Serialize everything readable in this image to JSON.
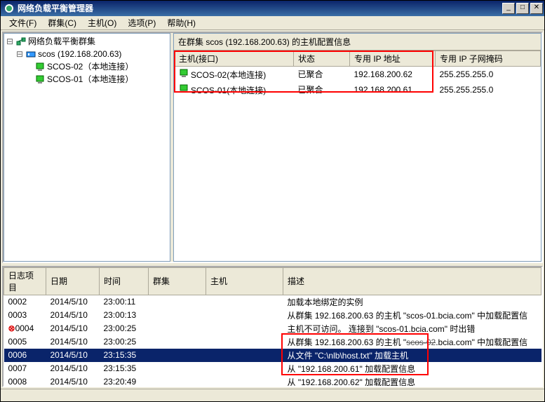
{
  "window": {
    "title": "网络负载平衡管理器"
  },
  "menus": {
    "file": "文件(F)",
    "cluster": "群集(C)",
    "host": "主机(O)",
    "options": "选项(P)",
    "help": "帮助(H)"
  },
  "tree": {
    "root": "网络负载平衡群集",
    "cluster": "scos (192.168.200.63)",
    "hosts": [
      "SCOS-02（本地连接）",
      "SCOS-01（本地连接）"
    ]
  },
  "list": {
    "caption": "在群集 scos (192.168.200.63) 的主机配置信息",
    "headers": {
      "host": "主机(接口)",
      "status": "状态",
      "dip": "专用 IP 地址",
      "mask": "专用 IP 子网掩码"
    },
    "rows": [
      {
        "host": "SCOS-02(本地连接)",
        "status": "已聚合",
        "dip": "192.168.200.62",
        "mask": "255.255.255.0"
      },
      {
        "host": "SCOS-01(本地连接)",
        "status": "已聚合",
        "dip": "192.168.200.61",
        "mask": "255.255.255.0"
      }
    ]
  },
  "log": {
    "headers": {
      "item": "日志项目",
      "date": "日期",
      "time": "时间",
      "cluster": "群集",
      "host": "主机",
      "desc": "描述"
    },
    "rows": [
      {
        "id": "0002",
        "date": "2014/5/10",
        "time": "23:00:11",
        "desc": "加载本地绑定的实例"
      },
      {
        "id": "0003",
        "date": "2014/5/10",
        "time": "23:00:13",
        "desc": "从群集 192.168.200.63 的主机 \"scos-01.bcia.com\" 中加载配置信"
      },
      {
        "id": "0004",
        "date": "2014/5/10",
        "time": "23:00:25",
        "desc": "主机不可访问。 连接到 \"scos-01.bcia.com\" 时出错",
        "err": true
      },
      {
        "id": "0005",
        "date": "2014/5/10",
        "time": "23:00:25",
        "desc_pre": "从群集 192.168.200.63 的主机 \"",
        "strike": "scos-02",
        "desc_post": ".bcia.com\" 中加载配置信"
      },
      {
        "id": "0006",
        "date": "2014/5/10",
        "time": "23:15:35",
        "desc": "从文件 \"C:\\nlb\\host.txt\" 加载主机",
        "selected": true
      },
      {
        "id": "0007",
        "date": "2014/5/10",
        "time": "23:15:35",
        "desc": "从 \"192.168.200.61\" 加载配置信息"
      },
      {
        "id": "0008",
        "date": "2014/5/10",
        "time": "23:20:49",
        "desc": "从 \"192.168.200.62\" 加载配置信息"
      }
    ]
  },
  "win_controls": {
    "min": "_",
    "max": "□",
    "close": "✕"
  }
}
